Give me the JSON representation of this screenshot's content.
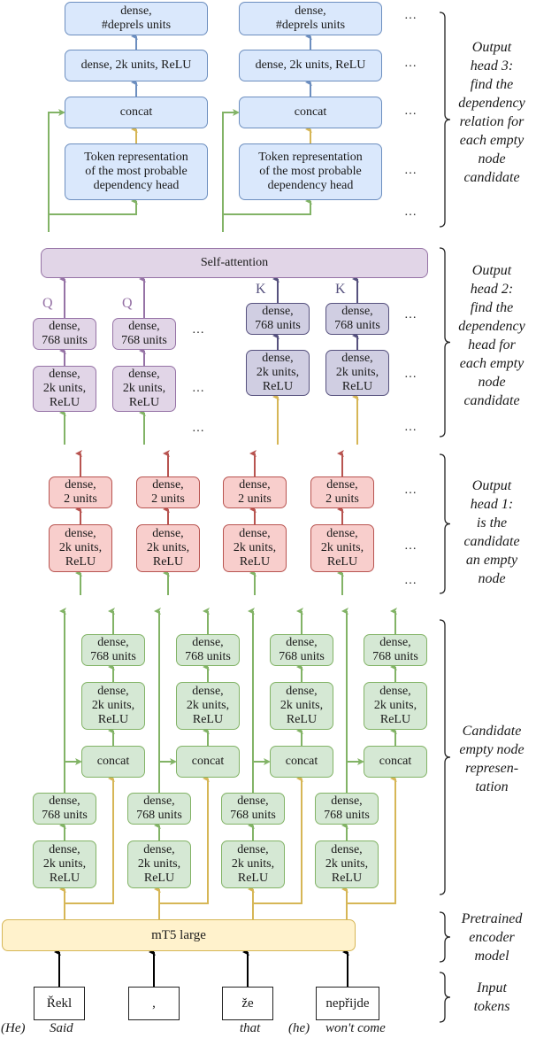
{
  "colors": {
    "head3_arrow": "#6c8ebf",
    "green_arrow": "#82b366",
    "yellow_arrow": "#d6b656",
    "query_arrow": "#9673a6",
    "key_arrow": "#56517e",
    "head1_arrow": "#b85450",
    "input_arrow": "#000000"
  },
  "head3": {
    "columns": [
      {
        "deprels": "dense,\n#deprels units",
        "dense2k": "dense, 2k units, ReLU",
        "concat": "concat",
        "token_repr": "Token representation\nof the most probable\ndependency head"
      },
      {
        "deprels": "dense,\n#deprels units",
        "dense2k": "dense, 2k units, ReLU",
        "concat": "concat",
        "token_repr": "Token representation\nof the most probable\ndependency head"
      }
    ],
    "ellipsis": "…",
    "description": "Output\nhead 3:\nfind the\ndependency\nrelation for\neach empty\nnode\ncandidate"
  },
  "head2": {
    "self_attention": "Self-attention",
    "query_label": "Q",
    "key_label": "K",
    "query_columns": [
      {
        "dense768": "dense,\n768 units",
        "dense2k": "dense,\n2k units,\nReLU"
      },
      {
        "dense768": "dense,\n768 units",
        "dense2k": "dense,\n2k units,\nReLU"
      }
    ],
    "key_columns": [
      {
        "dense768": "dense,\n768 units",
        "dense2k": "dense,\n2k units,\nReLU"
      },
      {
        "dense768": "dense,\n768 units",
        "dense2k": "dense,\n2k units,\nReLU"
      }
    ],
    "ellipsis": "…",
    "description": "Output\nhead 2:\nfind the\ndependency\nhead for\neach empty\nnode\ncandidate"
  },
  "head1": {
    "columns": [
      {
        "dense2": "dense,\n2 units",
        "dense2k": "dense,\n2k units,\nReLU"
      },
      {
        "dense2": "dense,\n2 units",
        "dense2k": "dense,\n2k units,\nReLU"
      },
      {
        "dense2": "dense,\n2 units",
        "dense2k": "dense,\n2k units,\nReLU"
      },
      {
        "dense2": "dense,\n2 units",
        "dense2k": "dense,\n2k units,\nReLU"
      }
    ],
    "ellipsis": "…",
    "description": "Output\nhead 1:\nis the\ncandidate\nan empty\nnode"
  },
  "candidate": {
    "columns": [
      {
        "upper768": "dense,\n768 units",
        "upper2k": "dense,\n2k units,\nReLU",
        "concat": "concat",
        "lower768": "dense,\n768 units",
        "lower2k": "dense,\n2k units,\nReLU"
      },
      {
        "upper768": "dense,\n768 units",
        "upper2k": "dense,\n2k units,\nReLU",
        "concat": "concat",
        "lower768": "dense,\n768 units",
        "lower2k": "dense,\n2k units,\nReLU"
      },
      {
        "upper768": "dense,\n768 units",
        "upper2k": "dense,\n2k units,\nReLU",
        "concat": "concat",
        "lower768": "dense,\n768 units",
        "lower2k": "dense,\n2k units,\nReLU"
      },
      {
        "upper768": "dense,\n768 units",
        "upper2k": "dense,\n2k units,\nReLU",
        "concat": "concat",
        "lower768": "dense,\n768 units",
        "lower2k": "dense,\n2k units,\nReLU"
      }
    ],
    "description": "Candidate\nempty node\nrepresen-\ntation"
  },
  "encoder": {
    "label": "mT5 large",
    "description": "Pretrained\nencoder\nmodel"
  },
  "input": {
    "tokens": [
      "Řekl",
      ",",
      "že",
      "nepřijde"
    ],
    "description": "Input\ntokens",
    "glosses": [
      "(He)",
      "Said",
      "that",
      "(he)",
      "won't come"
    ]
  }
}
